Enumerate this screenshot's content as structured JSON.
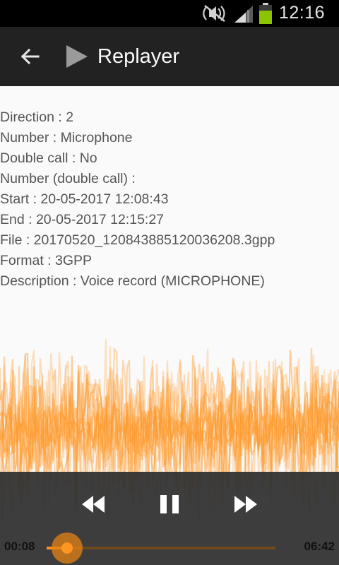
{
  "status_bar": {
    "time": "12:16",
    "icons": [
      "mute-icon",
      "signal-icon",
      "battery-icon"
    ],
    "battery_color": "#8bc400"
  },
  "app_bar": {
    "title": "Replayer",
    "background": "#222222",
    "icons": [
      "back-arrow-icon",
      "play-app-icon"
    ]
  },
  "details": [
    "Direction : 2",
    "Number : Microphone",
    "Double call : No",
    "Number (double call) :",
    "Start : 20-05-2017 12:08:43",
    "End : 20-05-2017 12:15:27",
    "File : 20170520_120843885120036208.3gpp",
    "Format : 3GPP",
    "Description : Voice record (MICROPHONE)"
  ],
  "waveform": {
    "color": "#ff9a2e"
  },
  "player": {
    "elapsed": "00:08",
    "total": "06:42",
    "progress": 0.09,
    "accent": "#ff8f1f",
    "icons": [
      "rewind-icon",
      "pause-icon",
      "fast-forward-icon"
    ]
  }
}
